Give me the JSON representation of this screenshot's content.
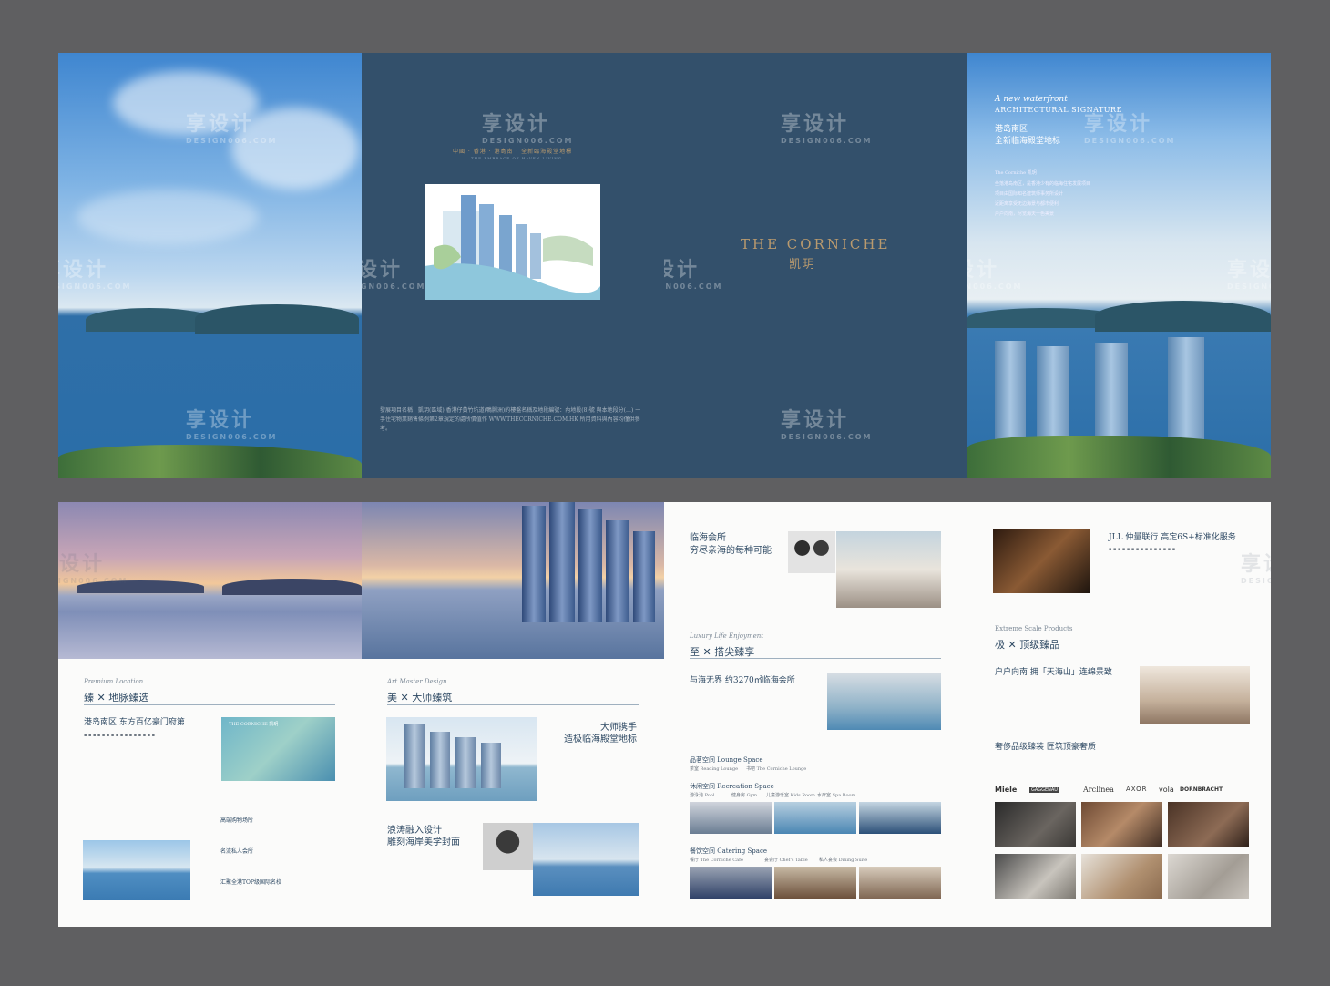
{
  "cover": {
    "brand": "THE CORNICHE",
    "brand_cn": "凯玥",
    "tagline": "中國 · 香港 · 港島南 · 全新臨海殿堂地標",
    "tagline_sub": "THE EMBRACE OF HAVEN LIVING",
    "disclaimer": "發展項目名稱：凱玥(區域) 香港仔黃竹坑道(鴨脷洲)的樓盤名稱及地段編號：內地段(8)號 與本地段分(…) 一手住宅物業銷售條例第2章規定的處所價值作 WWW.THECORNICHE.COM.HK 所用資料與內容均僅供參考。"
  },
  "signature": {
    "script": "A new waterfront",
    "caps": "ARCHITECTURAL SIGNATURE",
    "line1": "港岛南区",
    "line2": "全新临海殿堂地标",
    "intro_title": "The Corniche 凯玥",
    "intro_lines": [
      "坐落港岛南区，是香港少有的临海住宅发展项目",
      "项目由国际知名建筑师事务所设计",
      "近距离享受无边海景与都市便利",
      "户户向南，尽览海天一色美景"
    ]
  },
  "location": {
    "kicker": "Premium Location",
    "title": "臻 ✕ 地脉臻选",
    "headline": "港岛南区 东方百亿豪门府第",
    "list_heads": [
      "高端购物场所",
      "名流私人会所",
      "汇聚全港TOP级国际名校"
    ],
    "card_title": "THE CORNICHE 凯玥"
  },
  "design": {
    "kicker": "Art Master Design",
    "title": "美 ✕ 大师臻筑",
    "headline1": "大师携手",
    "headline2": "造极临海殿堂地标",
    "sub1": "浪涛融入设计",
    "sub2": "雕刻海岸美学封面"
  },
  "club": {
    "head1": "临海会所",
    "head2": "穷尽亲海的每种可能",
    "kicker": "Luxury Life Enjoyment",
    "title": "至 ✕ 搭尖臻享",
    "headline": "与海无界 约3270㎡临海会所",
    "lounge": "品茗空间 Lounge Space",
    "recreation": "休闲空间 Recreation Space",
    "catering": "餐饮空间 Catering Space",
    "lounge_items": [
      "茶室 Reading Lounge",
      "书吧 The Corniche Lounge"
    ],
    "recreation_items": [
      "游泳池 Pool",
      "健身房 Gym",
      "儿童游乐室 Kids Room",
      "水疗室 Spa Room"
    ],
    "catering_items": [
      "餐厅 The Corniche Cafe",
      "宴会厅 Chef's Table",
      "私人宴会 Dining Suite"
    ]
  },
  "service": {
    "head": "JLL 仲量联行 高定6S+标准化服务",
    "kicker": "Extreme Scale Products",
    "title": "极 ✕ 顶级臻品",
    "headline": "户户向南 拥「天海山」连绵景致",
    "headline2": "奢侈品级臻装 匠筑顶豪奢质",
    "brands": [
      "Miele",
      "GAGGENAU",
      "Arclinea",
      "AXOR",
      "vola",
      "DORNBRACHT"
    ]
  },
  "watermark": {
    "cn": "享设计",
    "en": "DESIGN006.COM"
  }
}
